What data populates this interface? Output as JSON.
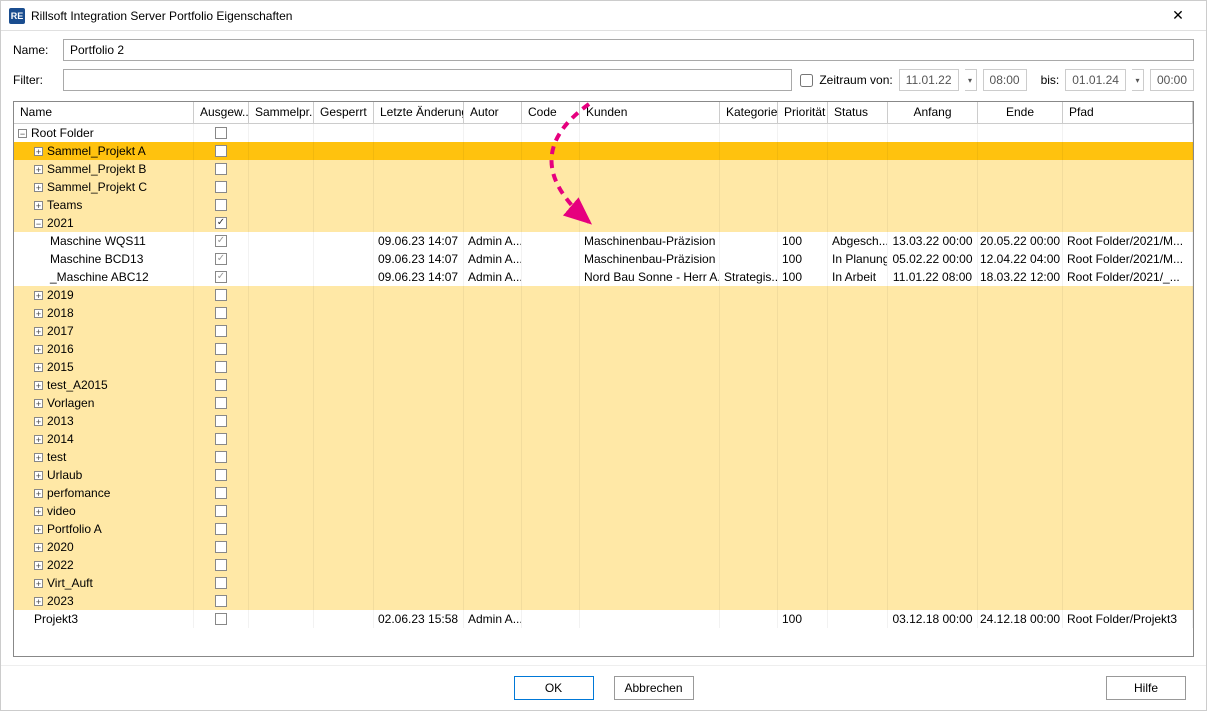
{
  "window": {
    "title": "Rillsoft Integration Server Portfolio Eigenschaften"
  },
  "form": {
    "nameLabel": "Name:",
    "nameValue": "Portfolio 2",
    "filterLabel": "Filter:",
    "zeitraumLabel": "Zeitraum von:",
    "bisLabel": "bis:",
    "dateFrom": "11.01.22",
    "timeFrom": "08:00",
    "dateTo": "01.01.24",
    "timeTo": "00:00"
  },
  "columns": {
    "name": "Name",
    "ausgew": "Ausgew...",
    "sammelpr": "Sammelpr...",
    "gesperrt": "Gesperrt",
    "letzte": "Letzte Änderung",
    "autor": "Autor",
    "code": "Code",
    "kunden": "Kunden",
    "kategorien": "Kategorien",
    "prioritaet": "Priorität",
    "status": "Status",
    "anfang": "Anfang",
    "ende": "Ende",
    "pfad": "Pfad"
  },
  "rows": [
    {
      "indent": 0,
      "icon": "minus",
      "name": "Root Folder",
      "cls": "white",
      "chk": "empty"
    },
    {
      "indent": 1,
      "icon": "plus",
      "name": "Sammel_Projekt A",
      "cls": "highlight",
      "chk": "empty"
    },
    {
      "indent": 1,
      "icon": "plus",
      "name": "Sammel_Projekt B",
      "cls": "stripe",
      "chk": "empty"
    },
    {
      "indent": 1,
      "icon": "plus",
      "name": "Sammel_Projekt C",
      "cls": "stripe",
      "chk": "empty"
    },
    {
      "indent": 1,
      "icon": "plus",
      "name": "Teams",
      "cls": "stripe",
      "chk": "empty"
    },
    {
      "indent": 1,
      "icon": "minus",
      "name": "2021",
      "cls": "stripe",
      "chk": "checked"
    },
    {
      "indent": 2,
      "icon": "",
      "name": "Maschine WQS11",
      "cls": "white",
      "chk": "greychecked",
      "letzte": "09.06.23 14:07",
      "autor": "Admin A...",
      "kunden": "Maschinenbau-Präzision ...",
      "prio": "100",
      "status": "Abgesch...",
      "anfang": "13.03.22 00:00",
      "ende": "20.05.22 00:00",
      "pfad": "Root Folder/2021/M..."
    },
    {
      "indent": 2,
      "icon": "",
      "name": "Maschine BCD13",
      "cls": "white",
      "chk": "greychecked",
      "letzte": "09.06.23 14:07",
      "autor": "Admin A...",
      "kunden": "Maschinenbau-Präzision ...",
      "prio": "100",
      "status": "In Planung",
      "anfang": "05.02.22 00:00",
      "ende": "12.04.22 04:00",
      "pfad": "Root Folder/2021/M..."
    },
    {
      "indent": 2,
      "icon": "",
      "name": "_Maschine ABC12",
      "cls": "white",
      "chk": "greychecked",
      "letzte": "09.06.23 14:07",
      "autor": "Admin A...",
      "kunden": "Nord Bau Sonne - Herr A...",
      "kat": "Strategis...",
      "prio": "100",
      "status": "In Arbeit",
      "anfang": "11.01.22 08:00",
      "ende": "18.03.22 12:00",
      "pfad": "Root Folder/2021/_..."
    },
    {
      "indent": 1,
      "icon": "plus",
      "name": "2019",
      "cls": "stripe",
      "chk": "empty"
    },
    {
      "indent": 1,
      "icon": "plus",
      "name": "2018",
      "cls": "stripe",
      "chk": "empty"
    },
    {
      "indent": 1,
      "icon": "plus",
      "name": "2017",
      "cls": "stripe",
      "chk": "empty"
    },
    {
      "indent": 1,
      "icon": "plus",
      "name": "2016",
      "cls": "stripe",
      "chk": "empty"
    },
    {
      "indent": 1,
      "icon": "plus",
      "name": "2015",
      "cls": "stripe",
      "chk": "empty"
    },
    {
      "indent": 1,
      "icon": "plus",
      "name": "test_A2015",
      "cls": "stripe",
      "chk": "empty"
    },
    {
      "indent": 1,
      "icon": "plus",
      "name": "Vorlagen",
      "cls": "stripe",
      "chk": "empty"
    },
    {
      "indent": 1,
      "icon": "plus",
      "name": "2013",
      "cls": "stripe",
      "chk": "empty"
    },
    {
      "indent": 1,
      "icon": "plus",
      "name": "2014",
      "cls": "stripe",
      "chk": "empty"
    },
    {
      "indent": 1,
      "icon": "plus",
      "name": "test",
      "cls": "stripe",
      "chk": "empty"
    },
    {
      "indent": 1,
      "icon": "plus",
      "name": "Urlaub",
      "cls": "stripe",
      "chk": "empty"
    },
    {
      "indent": 1,
      "icon": "plus",
      "name": "perfomance",
      "cls": "stripe",
      "chk": "empty"
    },
    {
      "indent": 1,
      "icon": "plus",
      "name": "video",
      "cls": "stripe",
      "chk": "empty"
    },
    {
      "indent": 1,
      "icon": "plus",
      "name": "Portfolio A",
      "cls": "stripe",
      "chk": "empty"
    },
    {
      "indent": 1,
      "icon": "plus",
      "name": "2020",
      "cls": "stripe",
      "chk": "empty"
    },
    {
      "indent": 1,
      "icon": "plus",
      "name": "2022",
      "cls": "stripe",
      "chk": "empty"
    },
    {
      "indent": 1,
      "icon": "plus",
      "name": "Virt_Auft",
      "cls": "stripe",
      "chk": "empty"
    },
    {
      "indent": 1,
      "icon": "plus",
      "name": "2023",
      "cls": "stripe",
      "chk": "empty"
    },
    {
      "indent": 1,
      "icon": "",
      "name": "Projekt3",
      "cls": "white",
      "chk": "empty",
      "letzte": "02.06.23 15:58",
      "autor": "Admin A...",
      "prio": "100",
      "anfang": "03.12.18 00:00",
      "ende": "24.12.18 00:00",
      "pfad": "Root Folder/Projekt3"
    }
  ],
  "buttons": {
    "ok": "OK",
    "cancel": "Abbrechen",
    "help": "Hilfe"
  }
}
